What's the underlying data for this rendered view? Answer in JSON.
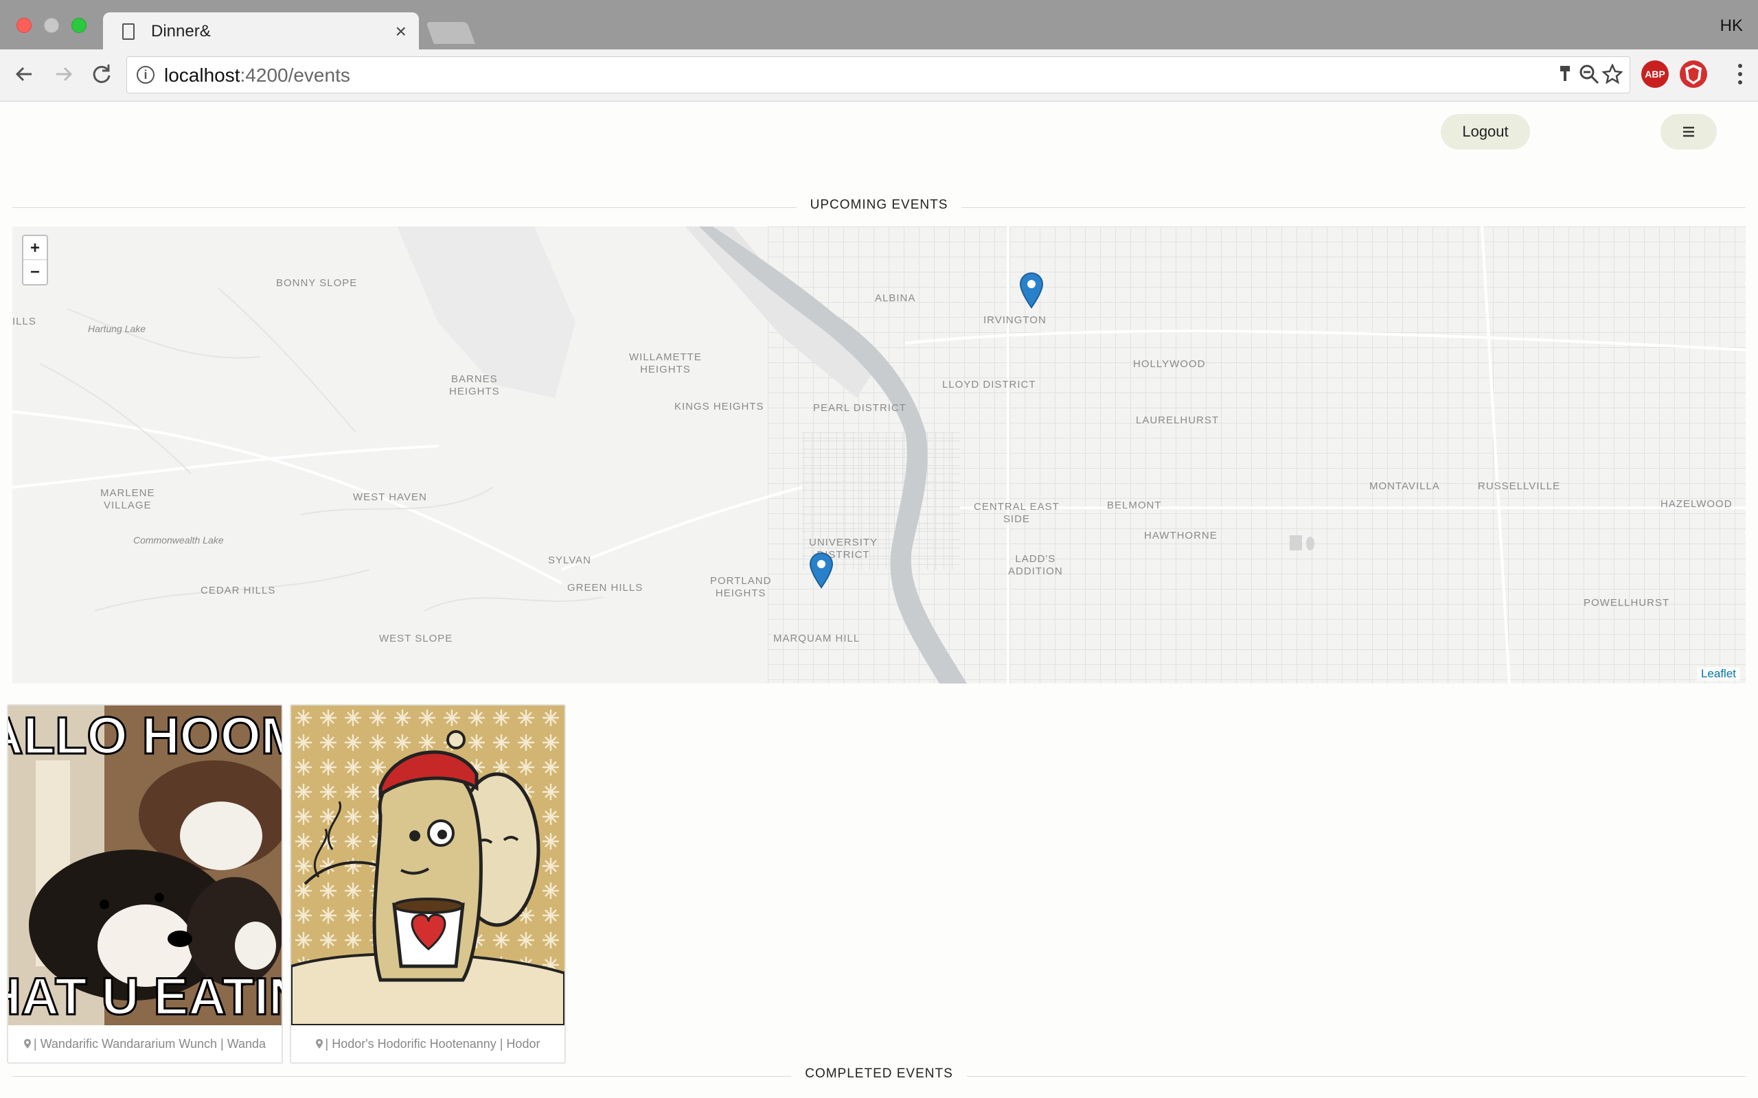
{
  "browser": {
    "tab_title": "Dinner&",
    "tab_close": "×",
    "profile": "HK",
    "url_host": "localhost",
    "url_path": ":4200/events",
    "back_icon": "arrow-left-icon",
    "forward_icon": "arrow-right-icon",
    "reload_icon": "reload-icon",
    "ext_abp": "ABP"
  },
  "header": {
    "logout_label": "Logout",
    "menu_icon": "≡"
  },
  "upcoming": {
    "title": "UPCOMING EVENTS"
  },
  "map": {
    "zoom_in": "+",
    "zoom_out": "−",
    "attribution": "Leaflet",
    "labels": {
      "bonny_slope": "BONNY SLOPE",
      "hartung_lake": "Hartung Lake",
      "ills": "ILLS",
      "albina": "ALBINA",
      "irvington": "IRVINGTON",
      "hollywood": "HOLLYWOOD",
      "lloyd": "LLOYD DISTRICT",
      "willamette_1": "WILLAMETTE",
      "willamette_2": "HEIGHTS",
      "barnes_1": "BARNES",
      "barnes_2": "HEIGHTS",
      "kings": "KINGS HEIGHTS",
      "pearl": "PEARL DISTRICT",
      "laurelhurst": "LAURELHURST",
      "marlene_1": "MARLENE",
      "marlene_2": "VILLAGE",
      "west_haven": "WEST HAVEN",
      "montavilla": "MONTAVILLA",
      "russellville": "RUSSELLVILLE",
      "hazelwood": "HAZELWOOD",
      "central_1": "CENTRAL EAST",
      "central_2": "SIDE",
      "belmont": "BELMONT",
      "hawthorne": "HAWTHORNE",
      "commonwealth": "Commonwealth Lake",
      "university_1": "UNIVERSITY",
      "university_2": "DISTRICT",
      "sylvan": "SYLVAN",
      "ladds_1": "LADD'S",
      "ladds_2": "ADDITION",
      "cedar": "CEDAR HILLS",
      "green": "GREEN HILLS",
      "portland_1": "PORTLAND",
      "portland_2": "HEIGHTS",
      "powellhurst": "POWELLHURST",
      "west_slope": "WEST SLOPE",
      "marquam": "MARQUAM HILL"
    }
  },
  "events": [
    {
      "caption": "| Wandarific Wandararium Wunch | Wanda",
      "meme_top": "ALLO HOOM",
      "meme_bottom": "HAT U EATIN"
    },
    {
      "caption": "| Hodor's Hodorific Hootenanny | Hodor"
    }
  ],
  "completed": {
    "title": "COMPLETED EVENTS"
  },
  "colors": {
    "marker": "#2a81cb",
    "pill": "#ebeedf",
    "river": "#c9cccf",
    "attribution": "#0078a8"
  }
}
